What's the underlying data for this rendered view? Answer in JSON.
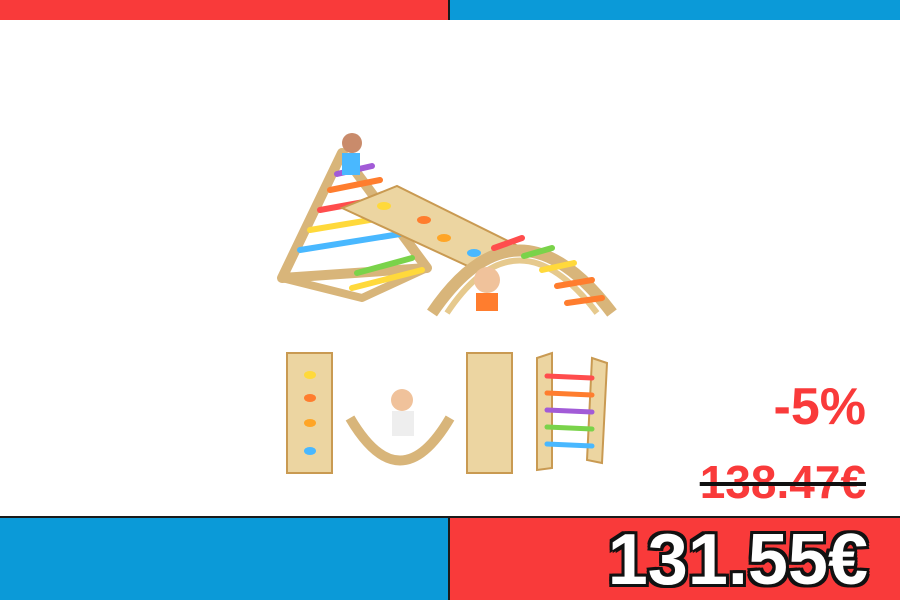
{
  "colors": {
    "red": "#f93a3a",
    "blue": "#0b9ad8",
    "dark": "#111111",
    "wood": "#e9cc94",
    "wood_dark": "#c99a52"
  },
  "price": {
    "discount": "-5%",
    "old_price": "138.47€",
    "current_price": "131.55€"
  },
  "product_image": {
    "icon": "climbing-triangle-ramp-arch-set-icon"
  }
}
